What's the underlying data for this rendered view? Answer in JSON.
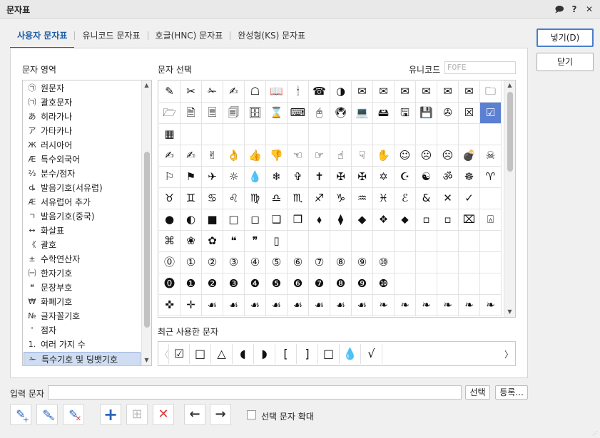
{
  "window": {
    "title": "문자표"
  },
  "titlebar_icons": [
    "chat-icon",
    "help-icon",
    "close-icon"
  ],
  "titlebar_glyphs": {
    "chat": "🗩",
    "help": "?",
    "close": "✕"
  },
  "tabs": [
    "사용자 문자표",
    "유니코드 문자표",
    "호글(HNC) 문자표",
    "완성형(KS) 문자표"
  ],
  "buttons": {
    "insert": "넣기(D)",
    "close": "닫기",
    "select": "선택",
    "register": "등록..."
  },
  "region": {
    "label": "문자 영역",
    "items": [
      {
        "icon": "㉠",
        "label": "원문자"
      },
      {
        "icon": "㈀",
        "label": "괄호문자"
      },
      {
        "icon": "あ",
        "label": "히라가나"
      },
      {
        "icon": "ア",
        "label": "가타카나"
      },
      {
        "icon": "Ж",
        "label": "러시아어"
      },
      {
        "icon": "Æ",
        "label": "특수외국어"
      },
      {
        "icon": "⅔",
        "label": "분수/점자"
      },
      {
        "icon": "ȡ",
        "label": "발음기호(서유럽)"
      },
      {
        "icon": "Æ",
        "label": "서유럽어 추가"
      },
      {
        "icon": "ㄱ",
        "label": "발음기호(중국)"
      },
      {
        "icon": "↔",
        "label": "화살표"
      },
      {
        "icon": "《",
        "label": "괄호"
      },
      {
        "icon": "±",
        "label": "수학연산자"
      },
      {
        "icon": "㈠",
        "label": "한자기호"
      },
      {
        "icon": "❝",
        "label": "문장부호"
      },
      {
        "icon": "₩",
        "label": "화폐기호"
      },
      {
        "icon": "№",
        "label": "글자꼴기호"
      },
      {
        "icon": "'",
        "label": "점자"
      },
      {
        "icon": "1.",
        "label": "여러 가지 수"
      },
      {
        "icon": "✁",
        "label": "특수기호 및 딩뱃기호"
      }
    ],
    "selected_index": 19
  },
  "selection": {
    "label": "문자 선택",
    "unicode_label": "유니코드",
    "unicode_value": "F0FE"
  },
  "grid": [
    "✎",
    "✂",
    "✁",
    "✍",
    "☖",
    "📖",
    "🕯",
    "☎",
    "◑",
    "✉",
    "✉",
    "✉",
    "✉",
    "✉",
    "✉",
    "🗀",
    "🗁",
    "🗎",
    "🗏",
    "🗐",
    "🗄",
    "⌛",
    "⌨",
    "🖰",
    "🖲",
    "💻",
    "🖴",
    "🖫",
    "💾",
    "✇",
    "☒",
    "☑",
    "▦",
    "",
    "",
    "",
    "",
    "",
    "",
    "",
    "",
    "",
    "",
    "",
    "",
    "",
    "",
    "",
    "✍",
    "✍",
    "✌",
    "👌",
    "👍",
    "👎",
    "☜",
    "☞",
    "☝",
    "☟",
    "✋",
    "☺",
    "☹",
    "☹",
    "💣",
    "☠",
    "⚐",
    "⚑",
    "✈",
    "☼",
    "💧",
    "❄",
    "✞",
    "✝",
    "✠",
    "✠",
    "✡",
    "☪",
    "☯",
    "ॐ",
    "☸",
    "♈",
    "♉",
    "♊",
    "♋",
    "♌",
    "♍",
    "♎",
    "♏",
    "♐",
    "♑",
    "♒",
    "♓",
    "ℰ",
    "&",
    "✕",
    "✓",
    "",
    "●",
    "◐",
    "■",
    "□",
    "◻",
    "❑",
    "❒",
    "⬧",
    "⧫",
    "◆",
    "❖",
    "⬥",
    "▫",
    "▫",
    "⌧",
    "⍓",
    "⌘",
    "❀",
    "✿",
    "❝",
    "❞",
    "▯",
    "",
    "",
    "",
    "",
    "",
    "",
    "",
    "",
    "",
    "",
    "⓪",
    "①",
    "②",
    "③",
    "④",
    "⑤",
    "⑥",
    "⑦",
    "⑧",
    "⑨",
    "⑩",
    "",
    "",
    "",
    "",
    "",
    "⓿",
    "❶",
    "❷",
    "❸",
    "❹",
    "❺",
    "❻",
    "❼",
    "❽",
    "❾",
    "❿",
    "",
    "",
    "",
    "",
    "",
    "✜",
    "✛",
    "☙",
    "☙",
    "☙",
    "☙",
    "☙",
    "☙",
    "☙",
    "☙",
    "❧",
    "❧",
    "❧",
    "❧",
    "❧",
    "❧"
  ],
  "grid_selected_index": 31,
  "recent": {
    "label": "최근 사용한 문자",
    "chars": [
      "☑",
      "□",
      "△",
      "◖",
      "◗",
      "[",
      "]",
      "□",
      "💧",
      "√"
    ]
  },
  "input": {
    "label": "입력 문자",
    "value": ""
  },
  "tools": [
    {
      "name": "add-char-icon",
      "glyph": "✎"
    },
    {
      "name": "edit-char-icon",
      "glyph": "✎"
    },
    {
      "name": "delete-char-icon",
      "glyph": "✎"
    },
    {
      "name": "plus-icon",
      "glyph": "+"
    },
    {
      "name": "insert-row-icon",
      "glyph": "⊞"
    },
    {
      "name": "remove-icon",
      "glyph": "✕"
    },
    {
      "name": "arrow-left-icon",
      "glyph": "←"
    },
    {
      "name": "arrow-right-icon",
      "glyph": "→"
    }
  ],
  "enlarge_label": "선택 문자 확대",
  "colors": {
    "accent": "#1c5fa8",
    "selection": "#5b7fd1",
    "red": "#d93a3a",
    "blue": "#2a64b8"
  }
}
